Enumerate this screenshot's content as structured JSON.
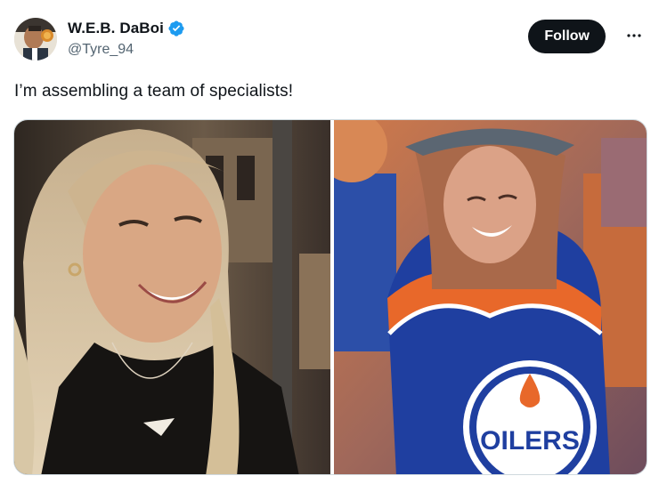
{
  "tweet": {
    "author": {
      "display_name": "W.E.B. DaBoi",
      "handle": "@Tyre_94",
      "verified": true,
      "avatar_icon": "avatar-photo"
    },
    "follow_label": "Follow",
    "more_icon": "more-horizontal-icon",
    "text": "I’m assembling a team of specialists!",
    "media": [
      {
        "description_icon": "photo-woman-smiling"
      },
      {
        "description_icon": "photo-fan-oilers-jersey",
        "jersey_text": "OILERS"
      }
    ]
  },
  "colors": {
    "verified_blue": "#1d9bf0",
    "follow_bg": "#0f1419",
    "handle_gray": "#536471",
    "oilers_blue": "#1f3fa0",
    "oilers_orange": "#e8682a"
  }
}
